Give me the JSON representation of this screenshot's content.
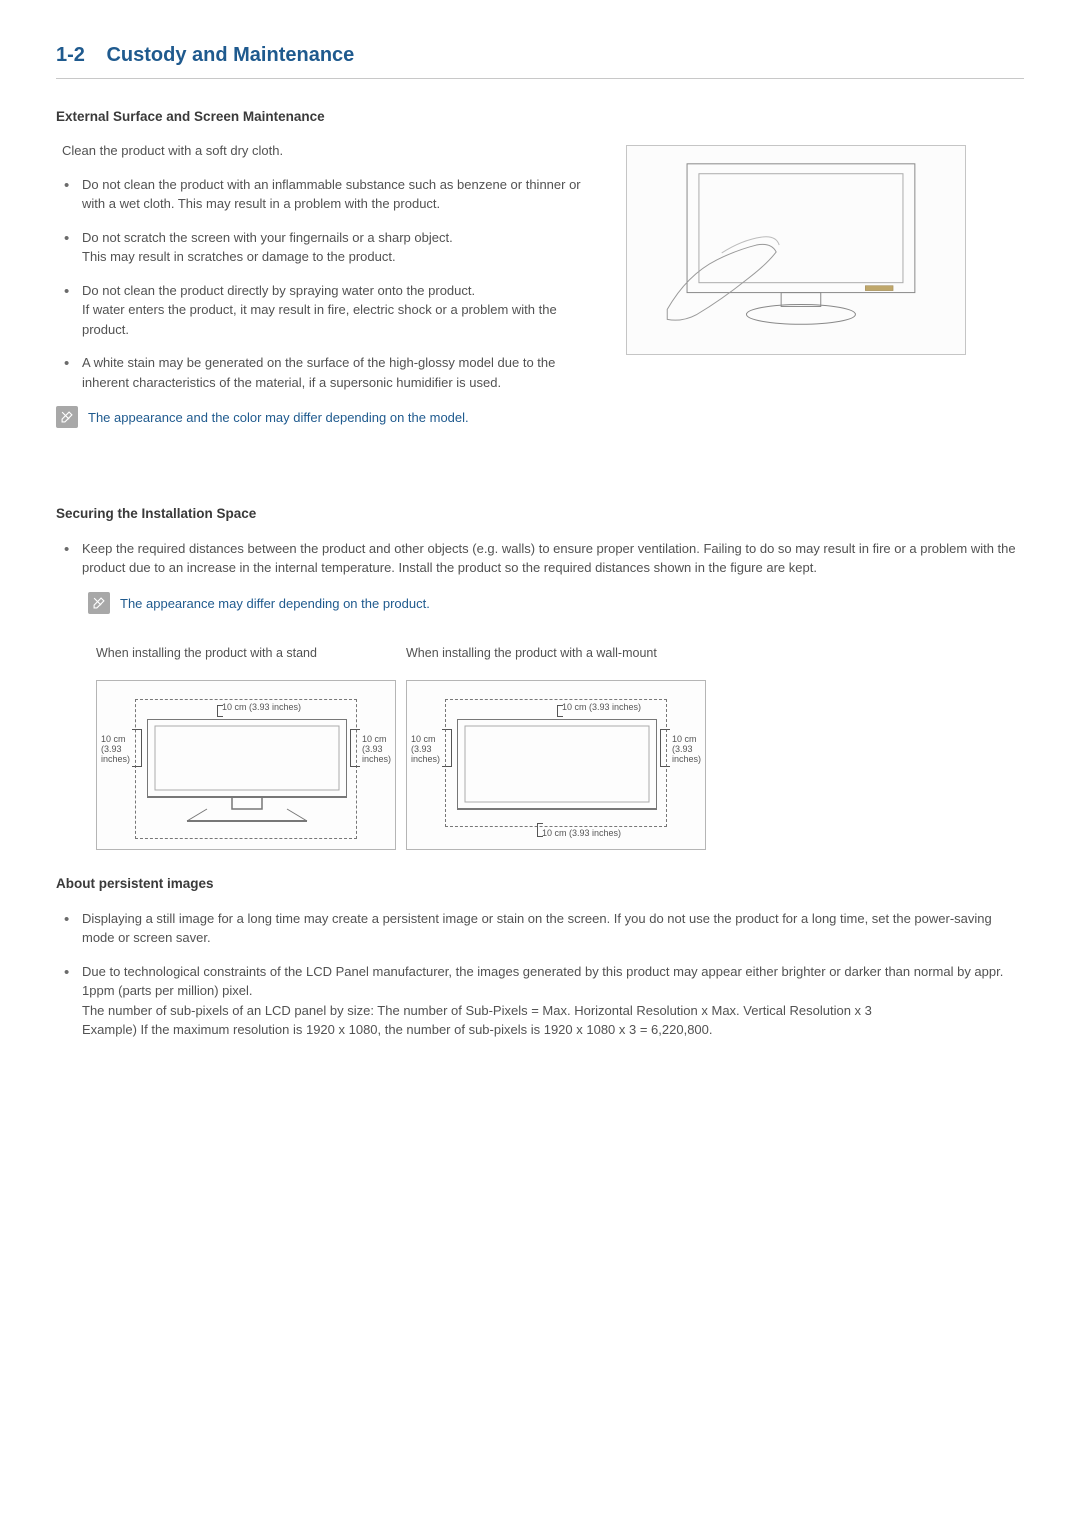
{
  "section": {
    "number": "1-2",
    "title": "Custody and Maintenance"
  },
  "maintenance": {
    "heading": "External Surface and Screen Maintenance",
    "intro": "Clean the product with a soft dry cloth.",
    "bullets": [
      "Do not clean the product with an inflammable substance such as benzene or thinner or with a wet cloth. This may result in a problem with the product.",
      "Do not scratch the screen with your fingernails or a sharp object.\nThis may result in scratches or damage to the product.",
      "Do not clean the product directly by spraying water onto the product.\nIf water enters the product, it may result in fire, electric shock or a problem with the product.",
      "A white stain may be generated on the surface of the high-glossy model due to the inherent characteristics of the material, if a supersonic humidifier is used."
    ],
    "note": "The appearance and the color may differ depending on the model."
  },
  "installation": {
    "heading": "Securing the Installation Space",
    "bullet": "Keep the required distances between the product and other objects (e.g. walls) to ensure proper ventilation. Failing to do so may result in fire or a problem with the product due to an increase in the internal temperature. Install the product so the required distances shown in the figure are kept.",
    "note": "The appearance may differ depending on the product.",
    "fig_captions": {
      "stand": "When installing the product with a stand",
      "wall": "When installing the product with a wall-mount"
    },
    "distances": {
      "top": "10 cm (3.93 inches)",
      "left": "10 cm (3.93 inches)",
      "right": "10 cm (3.93 inches)",
      "bottom": "10 cm (3.93 inches)",
      "side_label": "10 cm\n(3.93\ninches)"
    }
  },
  "persistent": {
    "heading": "About persistent images",
    "bullets": [
      "Displaying a still image for a long time may create a persistent image or stain on the screen. If you do not use the product for a long time, set the power-saving mode or screen saver.",
      "Due to technological constraints of the LCD Panel manufacturer, the images generated by this product may appear either brighter or darker than normal by appr. 1ppm (parts per million) pixel.\nThe number of sub-pixels of an LCD panel by size:  The number of Sub-Pixels = Max. Horizontal Resolution x Max. Vertical Resolution x 3\nExample) If the maximum resolution is 1920 x 1080, the number of sub-pixels is 1920 x 1080 x 3 = 6,220,800."
    ]
  }
}
